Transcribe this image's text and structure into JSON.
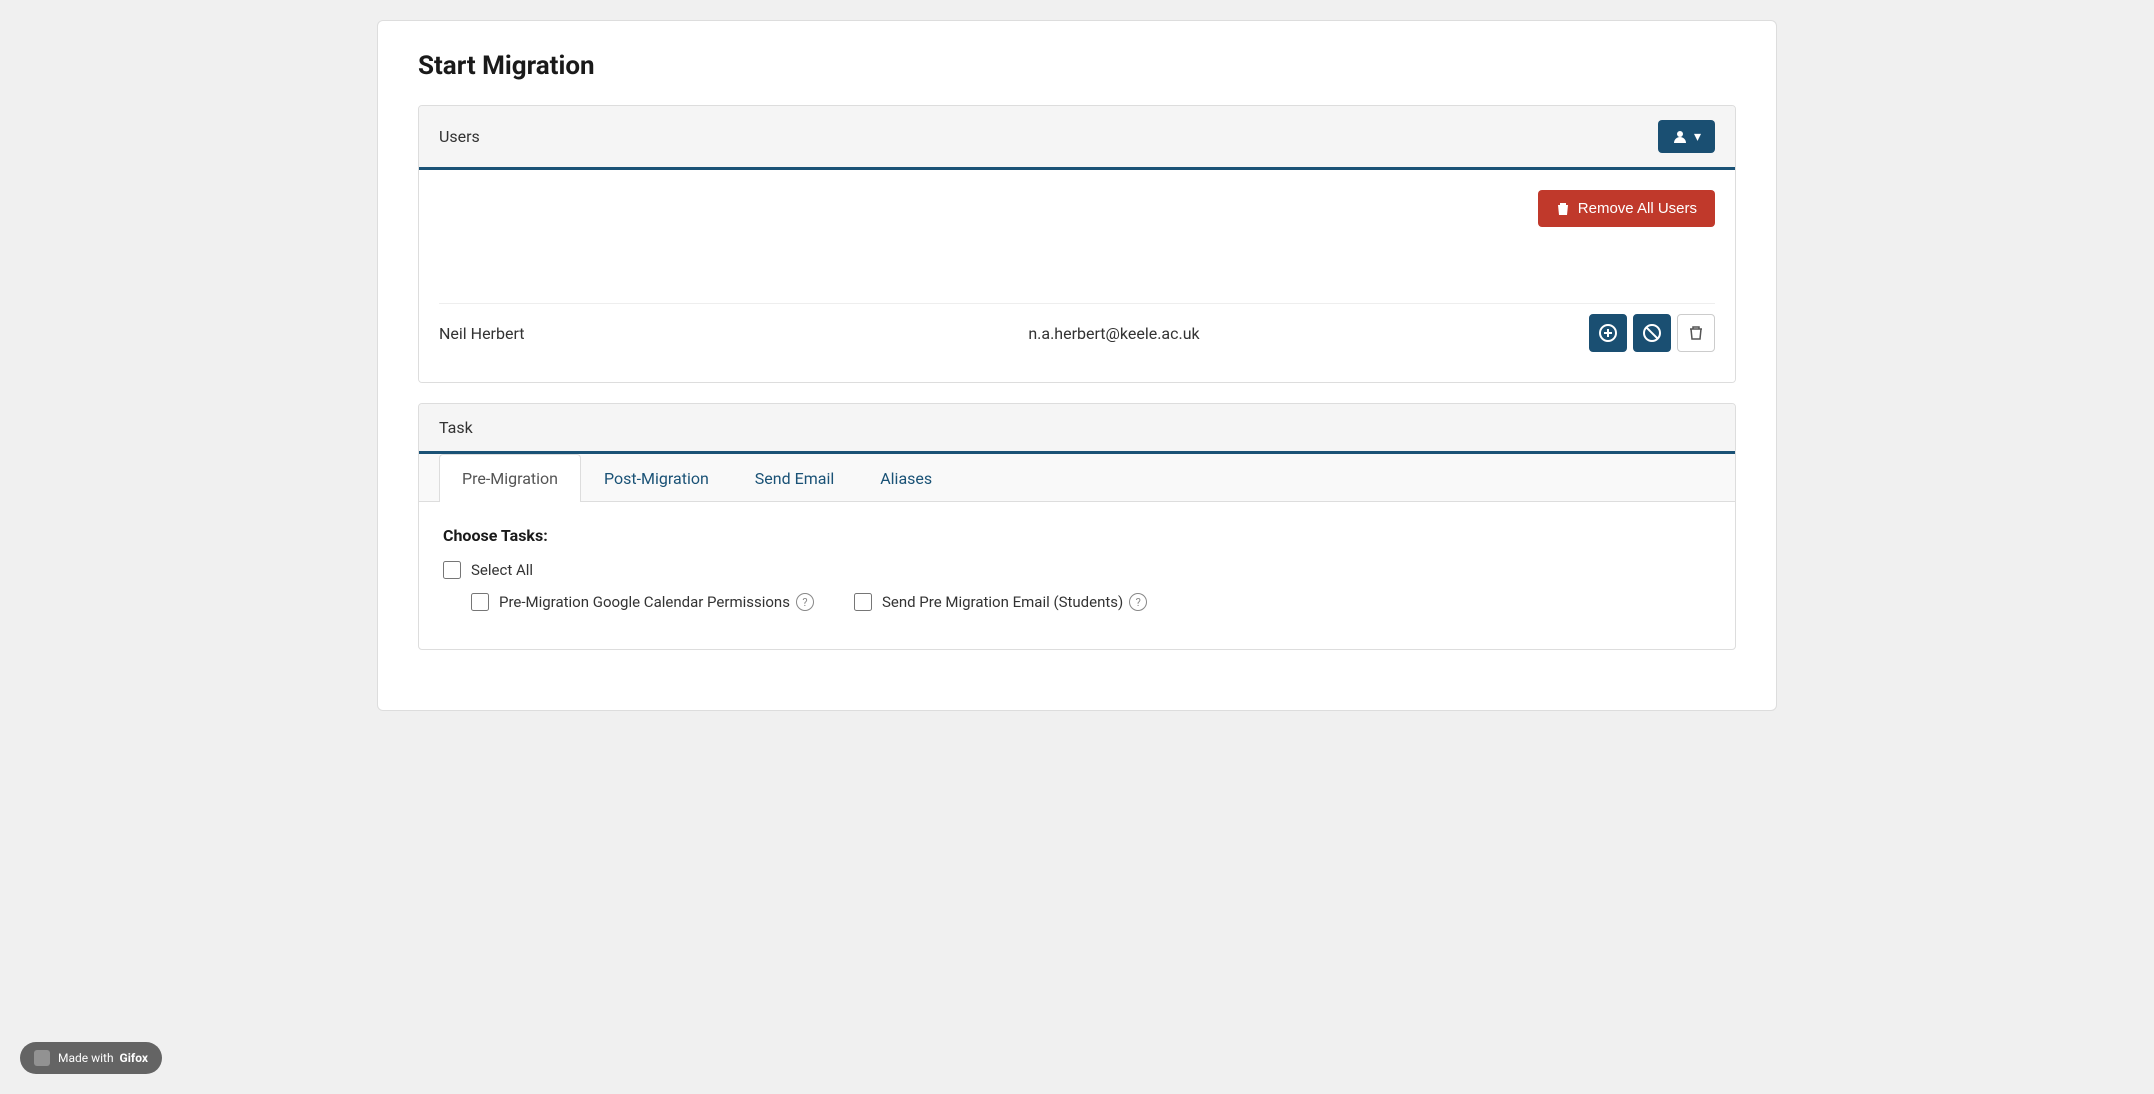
{
  "page": {
    "title": "Start Migration"
  },
  "users_section": {
    "header_label": "Users",
    "add_user_button_icon": "person-icon",
    "remove_all_button_label": "Remove All Users",
    "users": [
      {
        "name": "Neil Herbert",
        "email": "n.a.herbert@keele.ac.uk"
      }
    ]
  },
  "task_section": {
    "header_label": "Task",
    "tabs": [
      {
        "id": "pre-migration",
        "label": "Pre-Migration",
        "active": true
      },
      {
        "id": "post-migration",
        "label": "Post-Migration",
        "active": false
      },
      {
        "id": "send-email",
        "label": "Send Email",
        "active": false
      },
      {
        "id": "aliases",
        "label": "Aliases",
        "active": false
      }
    ],
    "choose_tasks_label": "Choose Tasks:",
    "select_all_label": "Select All",
    "task_checkboxes": [
      {
        "id": "gcal",
        "label": "Pre-Migration Google Calendar Permissions",
        "checked": false
      },
      {
        "id": "premig-email",
        "label": "Send Pre Migration Email (Students)",
        "checked": false
      }
    ]
  },
  "gifox": {
    "label": "Made with",
    "brand": "Gifox"
  }
}
